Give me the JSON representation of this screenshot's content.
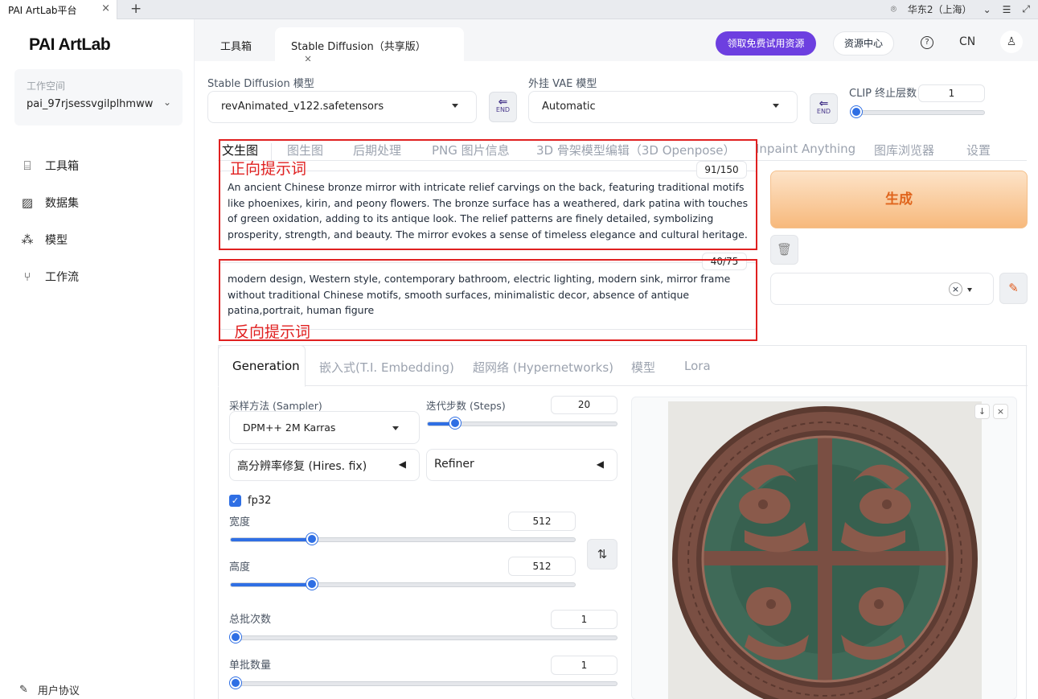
{
  "browser": {
    "tab_title": "PAI ArtLab平台",
    "close": "×",
    "new_tab": "+",
    "region": "华东2（上海）"
  },
  "sidebar": {
    "logo": "PAI ArtLab",
    "workspace_label": "工作空间",
    "workspace_value": "pai_97rjsessvgilplhmww",
    "items": [
      {
        "label": "工具箱",
        "icon": "toolbox-icon"
      },
      {
        "label": "数据集",
        "icon": "dataset-icon"
      },
      {
        "label": "模型",
        "icon": "model-icon"
      },
      {
        "label": "工作流",
        "icon": "workflow-icon"
      }
    ],
    "footer": "用户协议"
  },
  "header": {
    "tabs": [
      "工具箱",
      "Stable Diffusion（共享版）"
    ],
    "tab_close": "×",
    "trial_button": "领取免费试用资源",
    "resource_button": "资源中心",
    "help": "?",
    "lang": "CN"
  },
  "model": {
    "sd_label": "Stable Diffusion 模型",
    "sd_value": "revAnimated_v122.safetensors",
    "vae_label": "外挂 VAE 模型",
    "vae_value": "Automatic",
    "clip_label": "CLIP 终止层数",
    "clip_value": "1",
    "clip_fraction": 0.0,
    "end_label": "END"
  },
  "subtabs": [
    "文生图",
    "图生图",
    "后期处理",
    "PNG 图片信息",
    "3D 骨架模型编辑（3D Openpose）",
    "Inpaint Anything",
    "图库浏览器",
    "设置"
  ],
  "prompt": {
    "positive_text": "An ancient Chinese bronze mirror with intricate relief carvings on the back, featuring traditional motifs like phoenixes, kirin, and peony flowers. The bronze surface has a weathered, dark patina with touches of green oxidation, adding to its antique look. The relief patterns are finely detailed, symbolizing prosperity, strength, and beauty. The mirror evokes a sense of timeless elegance and cultural heritage.",
    "positive_counter": "91/150",
    "negative_text": "modern design, Western style, contemporary bathroom, electric lighting, modern sink, mirror frame without traditional Chinese motifs, smooth surfaces, minimalistic decor, absence of antique patina,portrait, human figure",
    "negative_counter": "40/75",
    "positive_annotation": "正向提示词",
    "negative_annotation": "反向提示词"
  },
  "actions": {
    "generate": "生成",
    "clear_style": "×"
  },
  "gen_tabs": [
    "Generation",
    "嵌入式(T.I. Embedding)",
    "超网络 (Hypernetworks)",
    "模型",
    "Lora"
  ],
  "generation": {
    "sampler_label": "采样方法 (Sampler)",
    "sampler_value": "DPM++ 2M Karras",
    "steps_label": "迭代步数 (Steps)",
    "steps_value": "20",
    "hires_label": "高分辨率修复 (Hires. fix)",
    "refiner_label": "Refiner",
    "fp32_label": "fp32",
    "fp32_checked": true,
    "width_label": "宽度",
    "width_value": "512",
    "height_label": "高度",
    "height_value": "512",
    "batch_count_label": "总批次数",
    "batch_count_value": "1",
    "batch_size_label": "单批数量",
    "batch_size_value": "1"
  },
  "output": {
    "download": "↓",
    "close": "×"
  },
  "colors": {
    "accent": "#2f6fe4",
    "trial": "#6d3fe0",
    "generate_text": "#e0651d",
    "annotation": "#e02020"
  }
}
